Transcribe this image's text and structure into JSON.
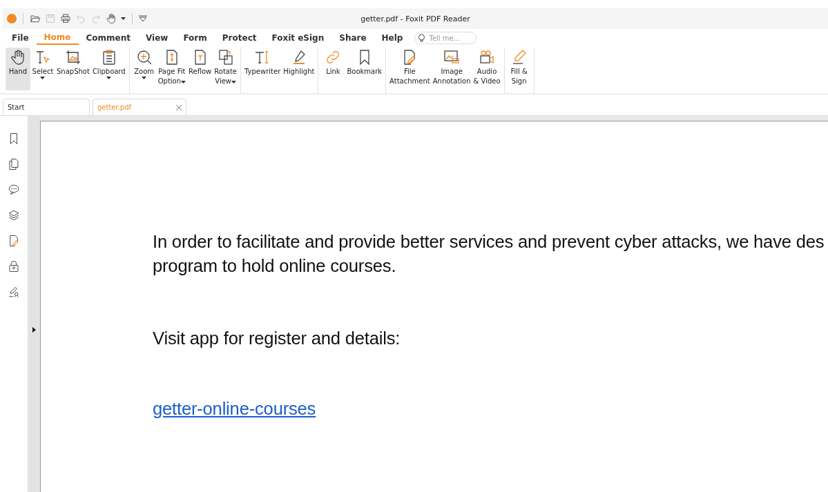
{
  "window": {
    "title": "getter.pdf - Foxit PDF Reader"
  },
  "quick_access": [
    {
      "kind": "open",
      "disabled": false
    },
    {
      "kind": "save",
      "disabled": true
    },
    {
      "kind": "print",
      "disabled": false
    },
    {
      "kind": "undo",
      "disabled": true
    },
    {
      "kind": "redo",
      "disabled": true
    },
    {
      "kind": "hand",
      "disabled": false
    }
  ],
  "menu": [
    {
      "label": "File",
      "selected": false
    },
    {
      "label": "Home",
      "selected": true
    },
    {
      "label": "Comment",
      "selected": false
    },
    {
      "label": "View",
      "selected": false
    },
    {
      "label": "Form",
      "selected": false
    },
    {
      "label": "Protect",
      "selected": false
    },
    {
      "label": "Foxit eSign",
      "selected": false
    },
    {
      "label": "Share",
      "selected": false
    },
    {
      "label": "Help",
      "selected": false
    }
  ],
  "search": {
    "placeholder": "Tell me..."
  },
  "ribbon": [
    [
      {
        "kind": "hand",
        "lines": [
          "Hand"
        ],
        "selected": true
      },
      {
        "kind": "select",
        "lines": [
          "Select"
        ],
        "caret_below": true,
        "selected": false
      },
      {
        "kind": "snapshot",
        "lines": [
          "SnapShot"
        ],
        "selected": false
      },
      {
        "kind": "clipboard",
        "lines": [
          "Clipboard"
        ],
        "caret_below": true,
        "selected": false
      }
    ],
    [
      {
        "kind": "zoom",
        "lines": [
          "Zoom"
        ],
        "caret_below": true,
        "selected": false
      },
      {
        "kind": "pagefit",
        "lines": [
          "Page Fit",
          "Option"
        ],
        "caret_inline": true,
        "selected": false
      },
      {
        "kind": "reflow",
        "lines": [
          "Reflow"
        ],
        "selected": false
      },
      {
        "kind": "rotate",
        "lines": [
          "Rotate",
          "View"
        ],
        "caret_inline": true,
        "selected": false
      }
    ],
    [
      {
        "kind": "typewriter",
        "lines": [
          "Typewriter"
        ],
        "selected": false
      },
      {
        "kind": "highlight",
        "lines": [
          "Highlight"
        ],
        "selected": false
      }
    ],
    [
      {
        "kind": "link",
        "lines": [
          "Link"
        ],
        "selected": false
      },
      {
        "kind": "bookmark",
        "lines": [
          "Bookmark"
        ],
        "selected": false
      }
    ],
    [
      {
        "kind": "attachment",
        "lines": [
          "File",
          "Attachment"
        ],
        "selected": false
      },
      {
        "kind": "image",
        "lines": [
          "Image",
          "Annotation"
        ],
        "selected": false
      },
      {
        "kind": "video",
        "lines": [
          "Audio",
          "& Video"
        ],
        "selected": false
      }
    ],
    [
      {
        "kind": "fillsign",
        "lines": [
          "Fill &",
          "Sign"
        ],
        "selected": false
      }
    ]
  ],
  "doc_tabs": [
    {
      "label": "Start",
      "selected": false,
      "closable": false
    },
    {
      "label": "getter.pdf",
      "selected": true,
      "closable": true
    }
  ],
  "sidebar": [
    {
      "kind": "bookmark"
    },
    {
      "kind": "pages"
    },
    {
      "kind": "comments"
    },
    {
      "kind": "layers"
    },
    {
      "kind": "attachment"
    },
    {
      "kind": "security"
    },
    {
      "kind": "signature"
    }
  ],
  "document": {
    "paragraphs": [
      {
        "lines": [
          "In order to facilitate and provide better services and prevent cyber attacks, we have des",
          "program to hold online courses."
        ]
      },
      {
        "lines": [
          "Visit app for register and details:"
        ]
      }
    ],
    "link": "getter-online-courses"
  }
}
